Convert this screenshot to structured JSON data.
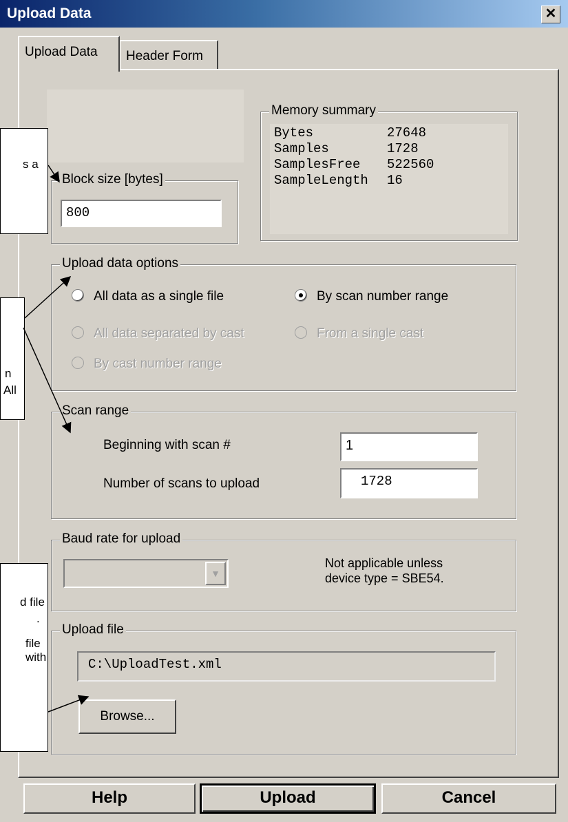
{
  "window": {
    "title": "Upload Data",
    "close_label": "✕"
  },
  "tabs": [
    {
      "label": "Upload Data",
      "active": true
    },
    {
      "label": "Header Form",
      "active": false
    }
  ],
  "block_size": {
    "legend": "Block size [bytes]",
    "value": "800"
  },
  "memory_summary": {
    "legend": "Memory summary",
    "rows": [
      {
        "key": "Bytes",
        "value": "27648"
      },
      {
        "key": "Samples",
        "value": "1728"
      },
      {
        "key": "SamplesFree",
        "value": "522560"
      },
      {
        "key": "SampleLength",
        "value": "16"
      }
    ]
  },
  "upload_options": {
    "legend": "Upload data options",
    "options": [
      {
        "label": "All data as a single file",
        "checked": false,
        "enabled": true
      },
      {
        "label": "By scan number range",
        "checked": true,
        "enabled": true
      },
      {
        "label": "All data separated by cast",
        "checked": false,
        "enabled": false
      },
      {
        "label": "From a single cast",
        "checked": false,
        "enabled": false
      },
      {
        "label": "By cast number range",
        "checked": false,
        "enabled": false
      }
    ]
  },
  "scan_range": {
    "legend": "Scan range",
    "begin_label": "Beginning with scan #",
    "begin_value": "1",
    "count_label": "Number of scans to upload",
    "count_value": "1728"
  },
  "baud": {
    "legend": "Baud rate for upload",
    "selected": "",
    "note_line1": "Not applicable unless",
    "note_line2": "device type = SBE54."
  },
  "upload_file": {
    "legend": "Upload file",
    "path": "C:\\UploadTest.xml",
    "browse_label": "Browse..."
  },
  "buttons": {
    "help": "Help",
    "upload": "Upload",
    "cancel": "Cancel"
  },
  "callouts": {
    "c1": [
      "s a"
    ],
    "c2": [
      "n",
      "All"
    ],
    "c3": [
      "d file",
      ".",
      "file",
      "with"
    ]
  }
}
